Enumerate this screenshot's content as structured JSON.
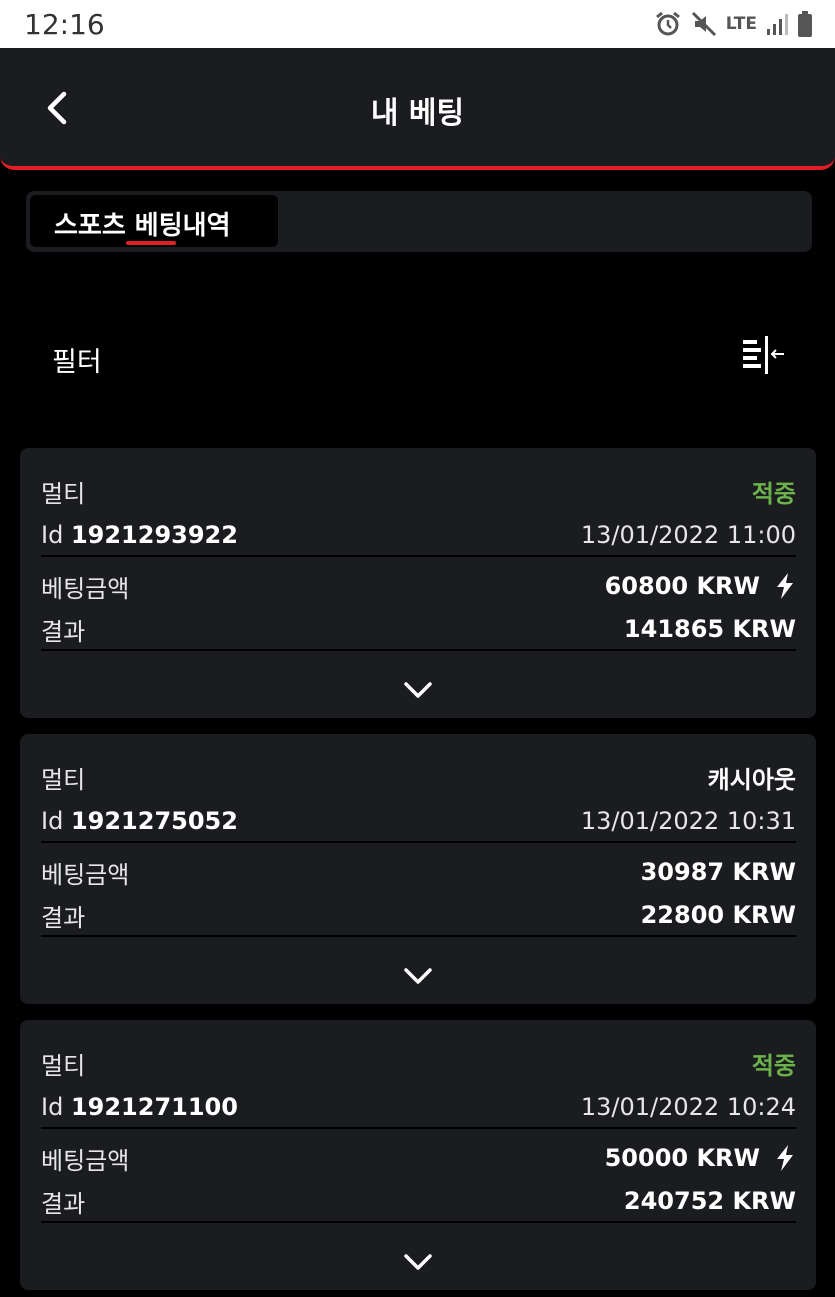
{
  "status_bar": {
    "time": "12:16",
    "network": "LTE"
  },
  "header": {
    "title": "내 베팅"
  },
  "tabs": {
    "sports_label": "스포츠 베팅내역"
  },
  "filter": {
    "label": "필터"
  },
  "colors": {
    "accent_red": "#e01e26",
    "won_green": "#6bb24a",
    "card_bg": "#1b1c20",
    "page_bg": "#000000"
  },
  "labels": {
    "id_prefix": "Id",
    "bet_amount": "베팅금액",
    "result": "결과"
  },
  "bets": [
    {
      "type": "멀티",
      "status": "적중",
      "status_kind": "won",
      "id": "1921293922",
      "datetime": "13/01/2022 11:00",
      "amount": "60800 KRW",
      "boosted": true,
      "result": "141865 KRW"
    },
    {
      "type": "멀티",
      "status": "캐시아웃",
      "status_kind": "cashout",
      "id": "1921275052",
      "datetime": "13/01/2022 10:31",
      "amount": "30987 KRW",
      "boosted": false,
      "result": "22800 KRW"
    },
    {
      "type": "멀티",
      "status": "적중",
      "status_kind": "won",
      "id": "1921271100",
      "datetime": "13/01/2022 10:24",
      "amount": "50000 KRW",
      "boosted": true,
      "result": "240752 KRW"
    }
  ]
}
